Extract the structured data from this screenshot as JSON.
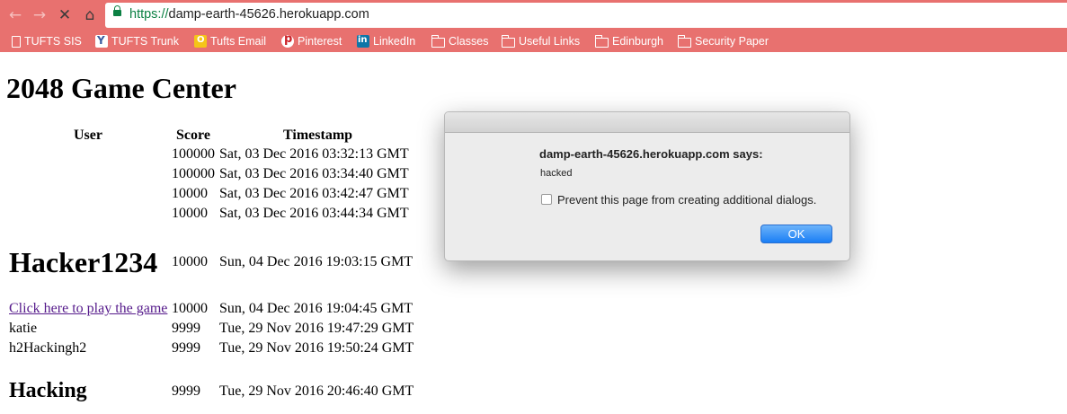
{
  "browser": {
    "url_scheme": "https://",
    "url_host": "damp-earth-45626.herokuapp.com",
    "bookmarks": [
      {
        "label": "TUFTS SIS",
        "icon": "document-icon"
      },
      {
        "label": "TUFTS Trunk",
        "icon": "trunk-icon"
      },
      {
        "label": "Tufts Email",
        "icon": "outlook-icon"
      },
      {
        "label": "Pinterest",
        "icon": "pinterest-icon"
      },
      {
        "label": "LinkedIn",
        "icon": "linkedin-icon"
      },
      {
        "label": "Classes",
        "icon": "folder-icon"
      },
      {
        "label": "Useful Links",
        "icon": "folder-icon"
      },
      {
        "label": "Edinburgh",
        "icon": "folder-icon"
      },
      {
        "label": "Security Paper",
        "icon": "folder-icon"
      }
    ],
    "chrome_color": "#e8716f"
  },
  "page": {
    "title": "2048 Game Center",
    "columns": {
      "user": "User",
      "score": "Score",
      "timestamp": "Timestamp"
    },
    "rows": [
      {
        "user": "",
        "score": "100000",
        "timestamp": "Sat, 03 Dec 2016 03:32:13 GMT"
      },
      {
        "user": "",
        "score": "100000",
        "timestamp": "Sat, 03 Dec 2016 03:34:40 GMT"
      },
      {
        "user": "",
        "score": "10000",
        "timestamp": "Sat, 03 Dec 2016 03:42:47 GMT"
      },
      {
        "user": "",
        "score": "10000",
        "timestamp": "Sat, 03 Dec 2016 03:44:34 GMT"
      },
      {
        "user": "Hacker1234",
        "score": "10000",
        "timestamp": "Sun, 04 Dec 2016 19:03:15 GMT"
      },
      {
        "user": "Click here to play the game",
        "score": "10000",
        "timestamp": "Sun, 04 Dec 2016 19:04:45 GMT"
      },
      {
        "user": "katie",
        "score": "9999",
        "timestamp": "Tue, 29 Nov 2016 19:47:29 GMT"
      },
      {
        "user": "h2Hackingh2",
        "score": "9999",
        "timestamp": "Tue, 29 Nov 2016 19:50:24 GMT"
      },
      {
        "user": "Hacking",
        "score": "9999",
        "timestamp": "Tue, 29 Nov 2016 20:46:40 GMT"
      }
    ]
  },
  "dialog": {
    "title": "damp-earth-45626.herokuapp.com says:",
    "message": "hacked",
    "checkbox_label": "Prevent this page from creating additional dialogs.",
    "checkbox_checked": false,
    "ok_label": "OK"
  }
}
